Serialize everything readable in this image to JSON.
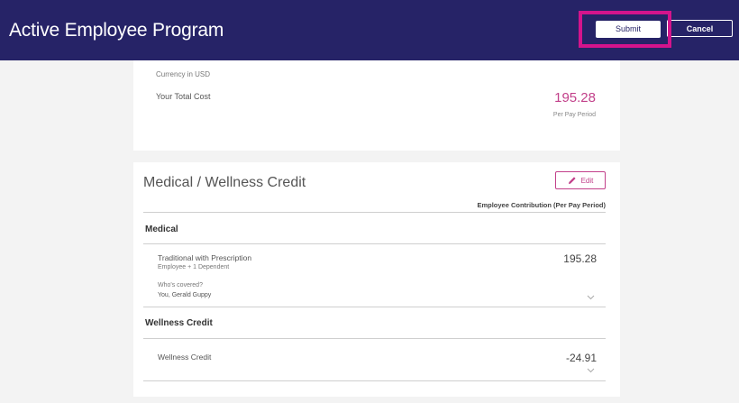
{
  "header": {
    "title": "Active Employee Program",
    "submit_label": "Submit",
    "cancel_label": "Cancel"
  },
  "cost_summary": {
    "currency_note": "Currency in USD",
    "total_cost_label": "Your Total Cost",
    "total_cost_value": "195.28",
    "period_label": "Per Pay Period"
  },
  "medical_section": {
    "title": "Medical / Wellness Credit",
    "edit_label": "Edit",
    "contribution_header": "Employee Contribution (Per Pay Period)",
    "groups": [
      {
        "title": "Medical",
        "plan_name": "Traditional with Prescription",
        "coverage_tier": "Employee + 1 Dependent",
        "covered_question": "Who's covered?",
        "covered_names": "You, Gerald Guppy",
        "amount": "195.28"
      },
      {
        "title": "Wellness Credit",
        "plan_name": "Wellness Credit",
        "amount": "-24.91"
      }
    ]
  },
  "colors": {
    "header_bg": "#262367",
    "accent": "#c2408a",
    "highlight": "#d4148c"
  },
  "icons": [
    "pencil-icon",
    "chevron-down-icon"
  ]
}
